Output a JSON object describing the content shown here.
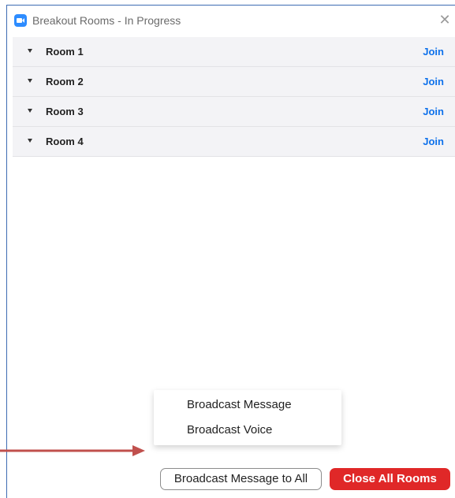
{
  "window": {
    "title": "Breakout Rooms - In Progress",
    "close_glyph": "✕"
  },
  "rooms": [
    {
      "name": "Room 1",
      "action": "Join"
    },
    {
      "name": "Room 2",
      "action": "Join"
    },
    {
      "name": "Room 3",
      "action": "Join"
    },
    {
      "name": "Room 4",
      "action": "Join"
    }
  ],
  "broadcast_menu": {
    "items": [
      "Broadcast Message",
      "Broadcast Voice"
    ]
  },
  "footer": {
    "broadcast_all_label": "Broadcast Message to All",
    "close_all_label": "Close All Rooms"
  },
  "colors": {
    "accent_blue": "#0e71eb",
    "close_red": "#e02828",
    "annotation_arrow": "#c0504d"
  }
}
